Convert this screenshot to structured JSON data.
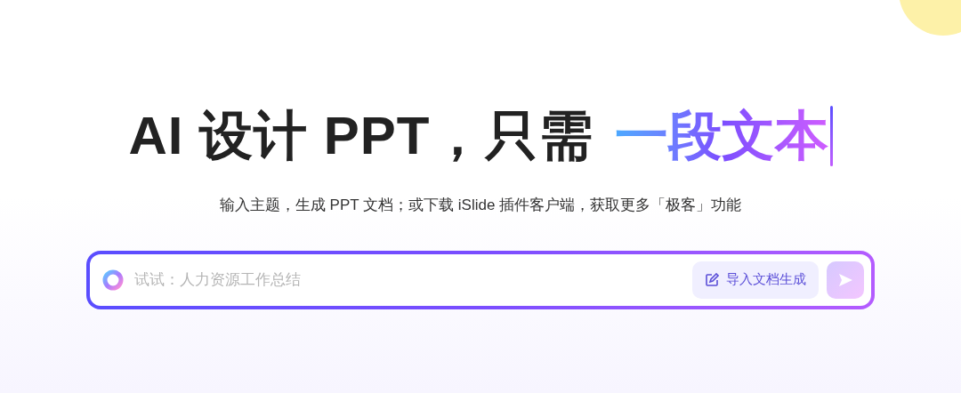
{
  "headline": {
    "text": "AI 设计 PPT，只需",
    "highlight": "一段文本"
  },
  "subtitle": "输入主题，生成 PPT 文档；或下载 iSlide 插件客户端，获取更多「极客」功能",
  "prompt_bar": {
    "placeholder": "试试：人力资源工作总结",
    "import_button": "导入文档生成"
  }
}
